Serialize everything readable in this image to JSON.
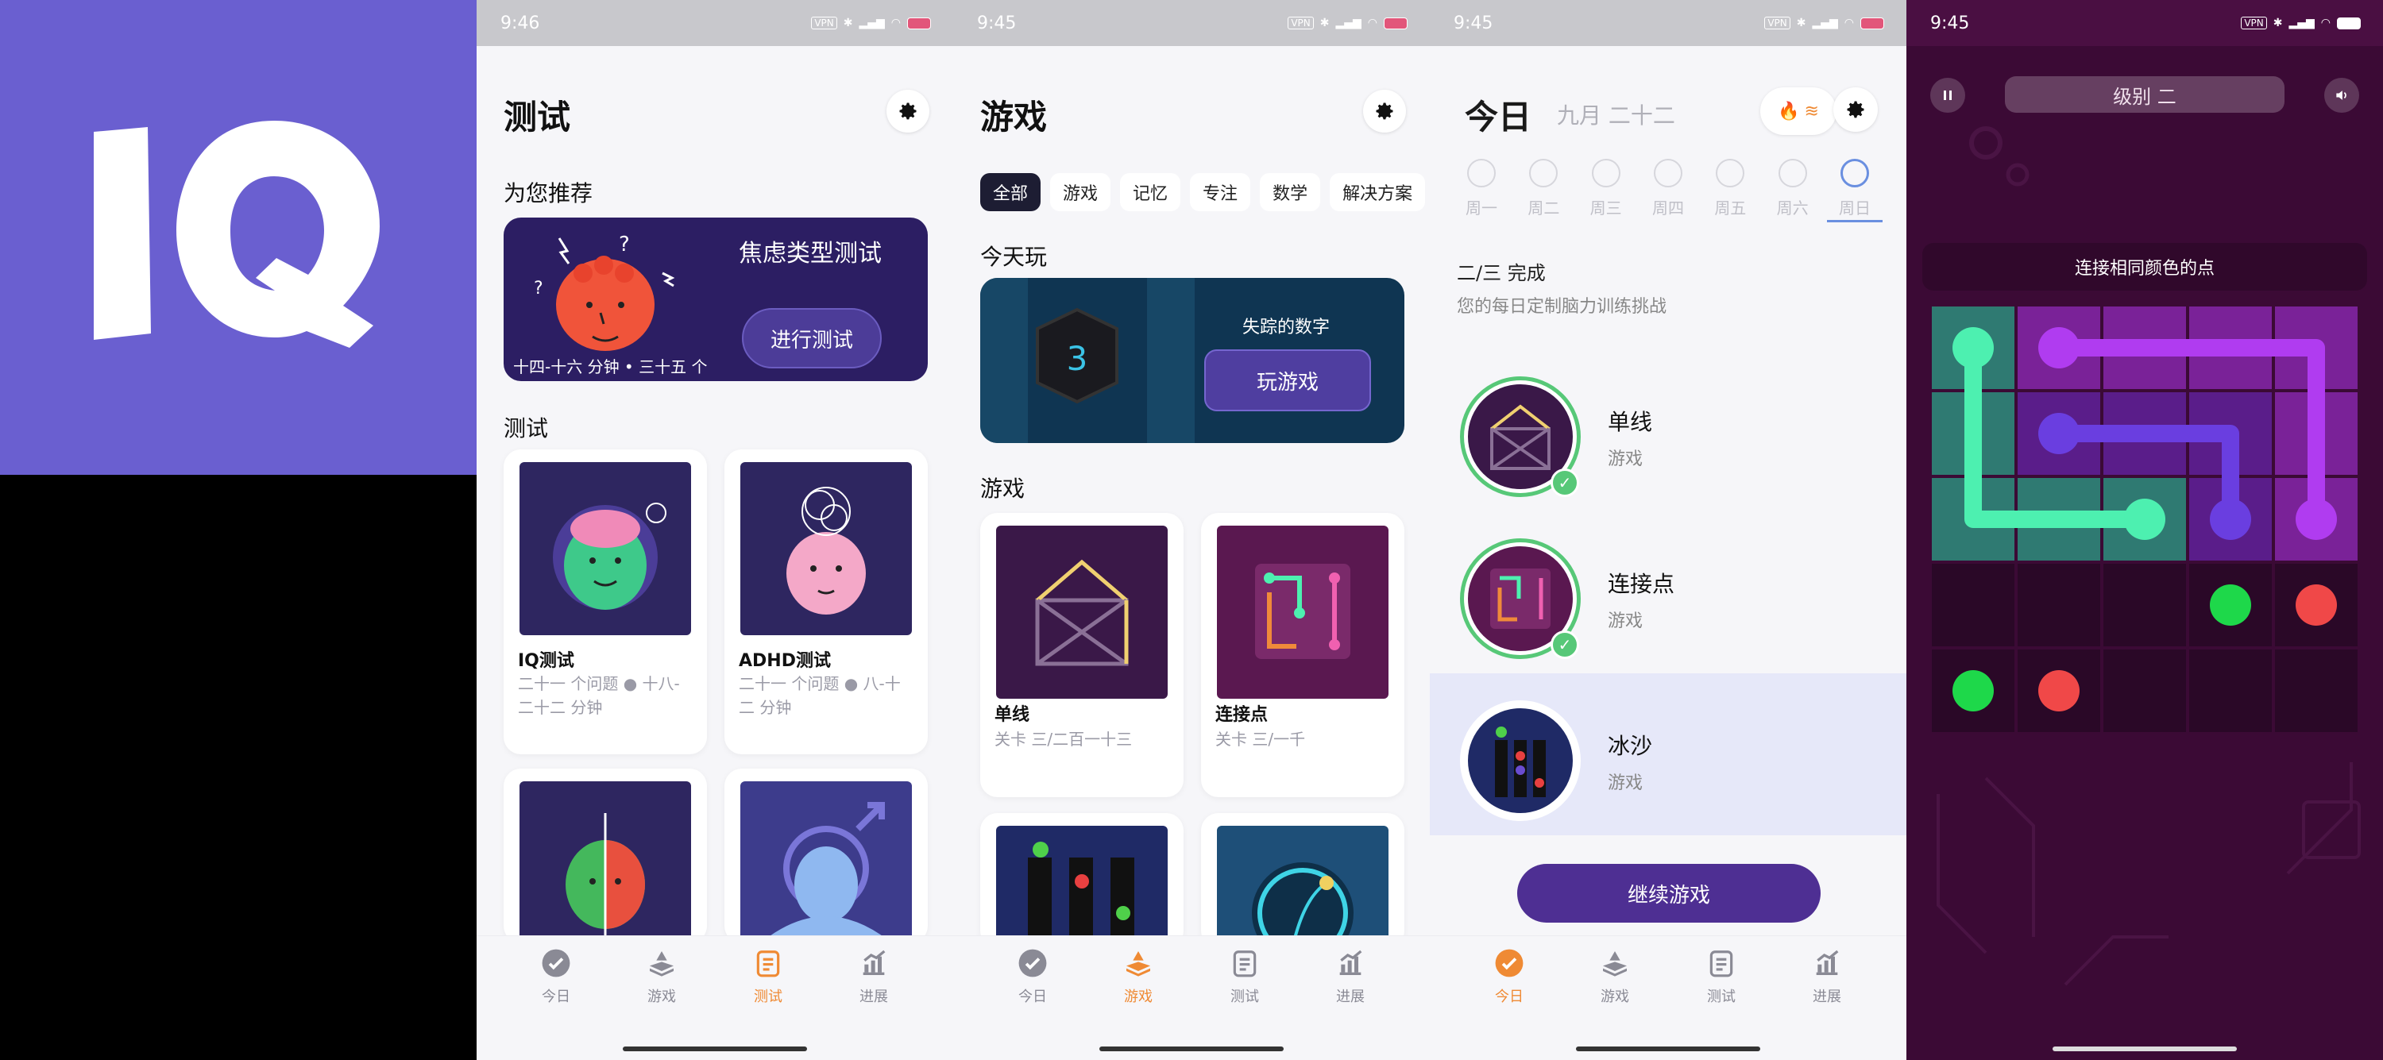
{
  "logo": {
    "text": "IQ",
    "bg": "#6a5fd0"
  },
  "accent": "#ef8a34",
  "nav": {
    "today": "今日",
    "games": "游戏",
    "tests": "测试",
    "progress": "进展"
  },
  "screen_tests": {
    "time": "9:46",
    "title": "测试",
    "recommended_heading": "为您推荐",
    "featured": {
      "title": "焦虑类型测试",
      "button": "进行测试",
      "meta": "十四-十六 分钟 • 三十五 个"
    },
    "tests_heading": "测试",
    "cards": [
      {
        "title": "IQ测试",
        "sub": "二十一 个问题 ● 十八-二十二 分钟"
      },
      {
        "title": "ADHD测试",
        "sub": "二十一 个问题 ● 八-十二 分钟"
      }
    ]
  },
  "screen_games": {
    "time": "9:45",
    "title": "游戏",
    "chips": [
      "全部",
      "游戏",
      "记忆",
      "专注",
      "数学",
      "解决方案"
    ],
    "today_heading": "今天玩",
    "daily": {
      "number": "3",
      "title": "失踪的数字",
      "button": "玩游戏"
    },
    "games_heading": "游戏",
    "cards": [
      {
        "title": "单线",
        "sub": "关卡 三/二百一十三"
      },
      {
        "title": "连接点",
        "sub": "关卡 三/一千"
      }
    ]
  },
  "screen_today": {
    "time": "9:45",
    "title": "今日",
    "date": "九月 二十二",
    "weekdays": [
      "周一",
      "周二",
      "周三",
      "周四",
      "周五",
      "周六",
      "周日"
    ],
    "progress": "二/三 完成",
    "progress_sub": "您的每日定制脑力训练挑战",
    "tasks": [
      {
        "title": "单线",
        "sub": "游戏",
        "done": true
      },
      {
        "title": "连接点",
        "sub": "游戏",
        "done": true
      },
      {
        "title": "冰沙",
        "sub": "游戏",
        "done": false
      }
    ],
    "continue_button": "继续游戏"
  },
  "screen_play": {
    "time": "9:45",
    "level": "级别 二",
    "instruction": "连接相同颜色的点",
    "colors": {
      "green_line": "#4df0b0",
      "purple_line": "#b03cf0",
      "dot_green": "#1ed84a",
      "dot_red": "#f04848"
    }
  },
  "statusbar": {
    "vpn": "VPN",
    "battery": "70"
  }
}
